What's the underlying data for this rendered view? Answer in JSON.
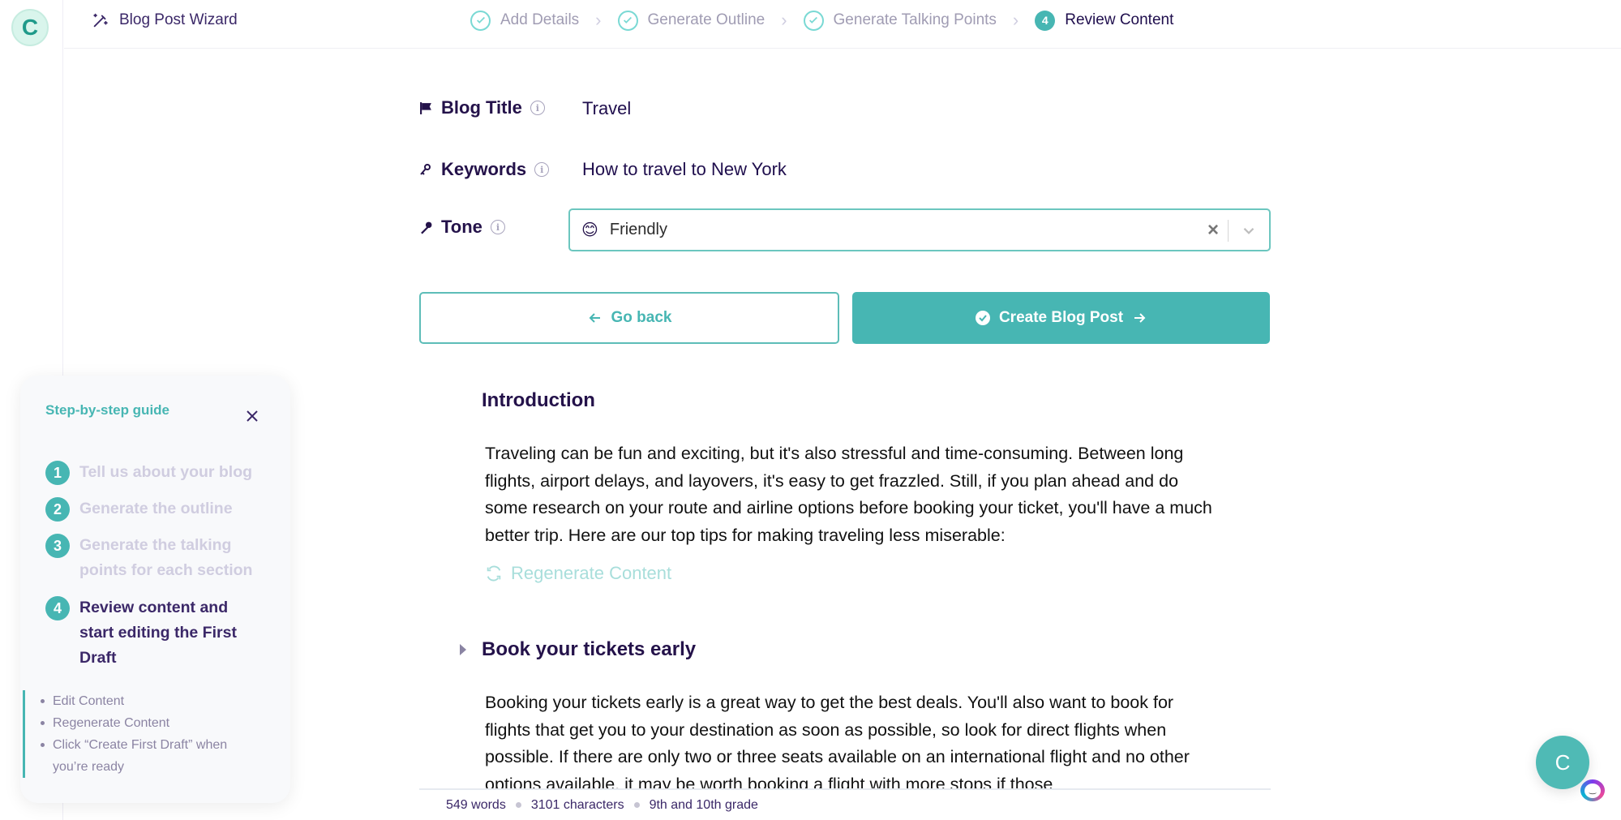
{
  "app": {
    "logo_letter": "C",
    "wizard_title": "Blog Post Wizard"
  },
  "steps": [
    {
      "label": "Add Details",
      "status": "complete"
    },
    {
      "label": "Generate Outline",
      "status": "complete"
    },
    {
      "label": "Generate Talking Points",
      "status": "complete"
    },
    {
      "label": "Review Content",
      "status": "active",
      "number": "4"
    }
  ],
  "form": {
    "blog_title": {
      "label": "Blog Title",
      "value": "Travel",
      "icon": "flag-icon"
    },
    "keywords": {
      "label": "Keywords",
      "value": "How to travel to New York",
      "icon": "key-icon"
    },
    "tone": {
      "label": "Tone",
      "value": "Friendly",
      "emoji": "😊",
      "icon": "microphone-icon"
    }
  },
  "buttons": {
    "go_back": "Go back",
    "create": "Create Blog Post"
  },
  "content": {
    "sections": [
      {
        "heading": "Introduction",
        "paragraph": "Traveling can be fun and exciting, but it's also stressful and time-consuming. Between long flights, airport delays, and layovers, it's easy to get frazzled. Still, if you plan ahead and do some research on your route and airline options before booking your ticket, you'll have a much better trip. Here are our top tips for making traveling less miserable:",
        "regenerate_label": "Regenerate Content"
      },
      {
        "heading": "Book your tickets early",
        "paragraph": "Booking your tickets early is a great way to get the best deals. You'll also want to book for flights that get you to your destination as soon as possible, so look for direct flights when possible. If there are only two or three seats available on an international flight and no other options available, it may be worth booking a flight with more stops if those"
      }
    ]
  },
  "status": {
    "words": "549 words",
    "characters": "3101 characters",
    "grade": "9th and 10th grade"
  },
  "guide": {
    "title": "Step-by-step guide",
    "steps": [
      {
        "number": "1",
        "label": "Tell us about your blog"
      },
      {
        "number": "2",
        "label": "Generate the outline"
      },
      {
        "number": "3",
        "label": "Generate the talking points for each section"
      },
      {
        "number": "4",
        "label": "Review content and start editing the First Draft"
      }
    ],
    "substeps": [
      "Edit Content",
      "Regenerate Content",
      "Click “Create First Draft” when you’re ready"
    ]
  },
  "chat": {
    "letter": "C"
  },
  "colors": {
    "accent": "#47b6b3",
    "primary_text": "#24124a",
    "muted_text": "#a09cb3"
  }
}
